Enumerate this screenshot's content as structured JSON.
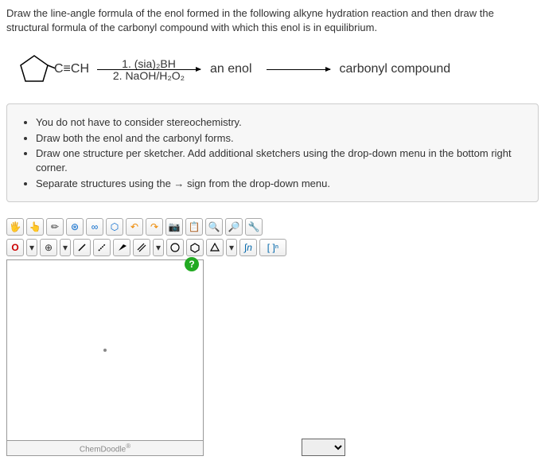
{
  "question": {
    "line1": "Draw the line-angle formula of the enol formed in the following alkyne hydration reaction and then draw the",
    "line2": "structural formula of the carbonyl compound with which this enol is in equilibrium."
  },
  "reaction": {
    "alkyne": "C≡CH",
    "reagent1": "1. (sia)₂BH",
    "reagent2": "2. NaOH/H₂O₂",
    "intermediate": "an enol",
    "product": "carbonyl compound"
  },
  "instructions": [
    "You do not have to consider stereochemistry.",
    "Draw both the enol and the carbonyl forms.",
    "Draw one structure per sketcher. Add additional sketchers using the drop-down menu in the bottom right corner.",
    "Separate structures using the → sign from the drop-down menu."
  ],
  "toolbar1": {
    "hand": "✋",
    "ptr": "↖",
    "edit": "✎",
    "target": "⊕",
    "chain": "⟶",
    "template": "⬡",
    "undo": "↶",
    "redo": "↷",
    "cam": "⎙",
    "paste": "📋",
    "zoomin": "⊕",
    "zoomout": "⊖",
    "tools": "✎"
  },
  "toolbar2": {
    "atom_o": "O",
    "caret": "▾",
    "charge": "⊕",
    "caret2": "▾",
    "bond1": "╱",
    "bond2": "╱",
    "bond3": "╱",
    "bond4": "╱",
    "caret3": "▾",
    "ring1": "○",
    "ring2": "◯",
    "ring3": "△",
    "caret4": "▾",
    "script": "∫n",
    "bracket": "[ ]ⁿ"
  },
  "help": "?",
  "footer": "ChemDoodle",
  "footer_sup": "®"
}
